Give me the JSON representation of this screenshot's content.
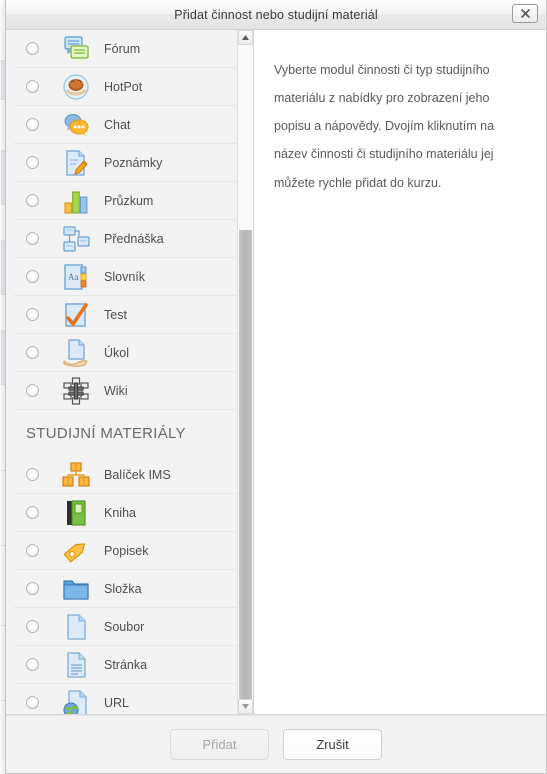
{
  "window": {
    "title": "Přidat činnost nebo studijní materiál",
    "close_icon": "close-icon"
  },
  "activities": {
    "items": [
      {
        "label": "Fórum",
        "icon": "forum-icon"
      },
      {
        "label": "HotPot",
        "icon": "hotpot-icon"
      },
      {
        "label": "Chat",
        "icon": "chat-icon"
      },
      {
        "label": "Poznámky",
        "icon": "notes-icon"
      },
      {
        "label": "Průzkum",
        "icon": "survey-icon"
      },
      {
        "label": "Přednáška",
        "icon": "lesson-icon"
      },
      {
        "label": "Slovník",
        "icon": "glossary-icon"
      },
      {
        "label": "Test",
        "icon": "quiz-icon"
      },
      {
        "label": "Úkol",
        "icon": "assignment-icon"
      },
      {
        "label": "Wiki",
        "icon": "wiki-icon"
      }
    ]
  },
  "resources": {
    "heading": "STUDIJNÍ MATERIÁLY",
    "items": [
      {
        "label": "Balíček IMS",
        "icon": "ims-package-icon"
      },
      {
        "label": "Kniha",
        "icon": "book-icon"
      },
      {
        "label": "Popisek",
        "icon": "label-icon"
      },
      {
        "label": "Složka",
        "icon": "folder-icon"
      },
      {
        "label": "Soubor",
        "icon": "file-icon"
      },
      {
        "label": "Stránka",
        "icon": "page-icon"
      },
      {
        "label": "URL",
        "icon": "url-icon"
      }
    ]
  },
  "description": {
    "text": "Vyberte modul činnosti či typ studijního materiálu z nabídky pro zobrazení jeho popisu a nápovědy. Dvojím kliknutím na název činnosti či studijního materiálu jej můžete rychle přidat do kurzu."
  },
  "footer": {
    "add_label": "Přidat",
    "cancel_label": "Zrušit"
  },
  "scrollbar": {
    "up_icon": "scroll-up-arrow-icon",
    "down_icon": "scroll-down-arrow-icon"
  },
  "colors": {
    "titlebar_text": "#3a3a3a",
    "list_bg": "#f3f3f3",
    "label_text": "#4d4d4d",
    "heading_text": "#6a6a6a",
    "body_text": "#5a5a5a",
    "accent_blue": "#7aadd8",
    "accent_green": "#8cc63f",
    "accent_orange": "#f5a623"
  }
}
